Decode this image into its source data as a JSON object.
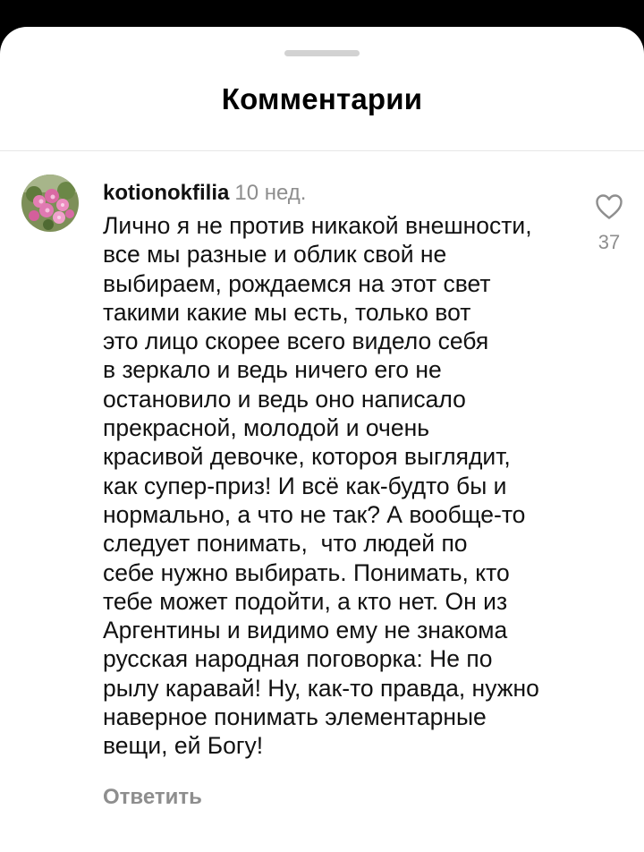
{
  "sheet": {
    "title": "Комментарии"
  },
  "comment": {
    "username": "kotionokfilia",
    "timestamp": "10 нед.",
    "text_lines": [
      "Лично я не против никакой внешности,",
      "все мы разные и облик свой не",
      "выбираем, рождаемся на этот свет",
      "такими какие мы есть, только вот",
      "это лицо скорее всего видело себя",
      "в зеркало и ведь ничего его не",
      "остановило и ведь оно написало",
      "прекрасной, молодой и очень",
      "красивой девочке, котороя выглядит,",
      "как супер-приз! И всё как-будто бы и",
      "нормально, а что не так? А вообще-то",
      "следует понимать,  что людей по",
      "себе нужно выбирать. Понимать, кто",
      "тебе может подойти, а кто нет. Он из",
      "Аргентины и видимо ему не знакома",
      "русская народная поговорка: Не по",
      "рылу каравай! Ну, как-то правда, нужно",
      "наверное понимать элементарные",
      "вещи, ей Богу!"
    ],
    "reply_label": "Ответить",
    "like_icon": "heart-outline-icon",
    "like_count": "37"
  },
  "colors": {
    "background": "#000000",
    "sheet": "#ffffff",
    "text": "#111111",
    "muted": "#8e8e8e",
    "handle": "#d2d2d2",
    "divider": "#e6e6e6"
  }
}
